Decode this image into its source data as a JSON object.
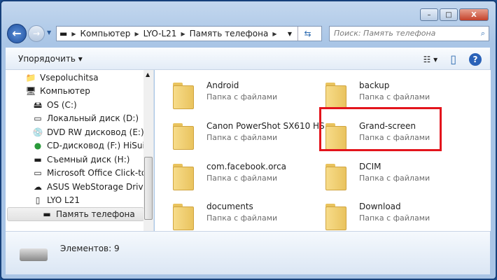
{
  "window": {
    "minimize": "–",
    "maximize": "□",
    "close": "X"
  },
  "nav": {
    "back": "←",
    "forward": "→",
    "breadcrumb": [
      "Компьютер",
      "LYO-L21",
      "Память телефона"
    ],
    "search_placeholder": "Поиск: Память телефона"
  },
  "toolbar": {
    "organize": "Упорядочить ▾",
    "views": "☷ ▾",
    "pane": "▯",
    "help": "?"
  },
  "tree": [
    {
      "label": "Vsepoluchitsa",
      "icon": "user-folder-icon",
      "indent": 1
    },
    {
      "label": "Компьютер",
      "icon": "computer-icon",
      "indent": 1
    },
    {
      "label": "OS (C:)",
      "icon": "windows-drive-icon",
      "indent": 2
    },
    {
      "label": "Локальный диск (D:)",
      "icon": "drive-icon",
      "indent": 2
    },
    {
      "label": "DVD RW дисковод (E:)",
      "icon": "dvd-icon",
      "indent": 2
    },
    {
      "label": "CD-дисковод (F:) HiSuite",
      "icon": "hisuite-icon",
      "indent": 2
    },
    {
      "label": "Съемный диск (H:)",
      "icon": "removable-drive-icon",
      "indent": 2
    },
    {
      "label": "Microsoft Office Click-to-",
      "icon": "drive-icon",
      "indent": 2
    },
    {
      "label": "ASUS WebStorage Drive",
      "icon": "cloud-icon",
      "indent": 2
    },
    {
      "label": "LYO  L21",
      "icon": "phone-icon",
      "indent": 2
    },
    {
      "label": "Память телефона",
      "icon": "removable-drive-icon",
      "indent": 3,
      "selected": true
    }
  ],
  "items": [
    {
      "name": "Android",
      "type": "Папка с файлами"
    },
    {
      "name": "backup",
      "type": "Папка с файлами"
    },
    {
      "name": "Canon PowerShot SX610 HS",
      "type": "Папка с файлами"
    },
    {
      "name": "Grand-screen",
      "type": "Папка с файлами"
    },
    {
      "name": "com.facebook.orca",
      "type": "Папка с файлами"
    },
    {
      "name": "DCIM",
      "type": "Папка с файлами"
    },
    {
      "name": "documents",
      "type": "Папка с файлами"
    },
    {
      "name": "Download",
      "type": "Папка с файлами"
    }
  ],
  "status": {
    "count": "Элементов: 9"
  },
  "highlight_color": "#e3141c"
}
